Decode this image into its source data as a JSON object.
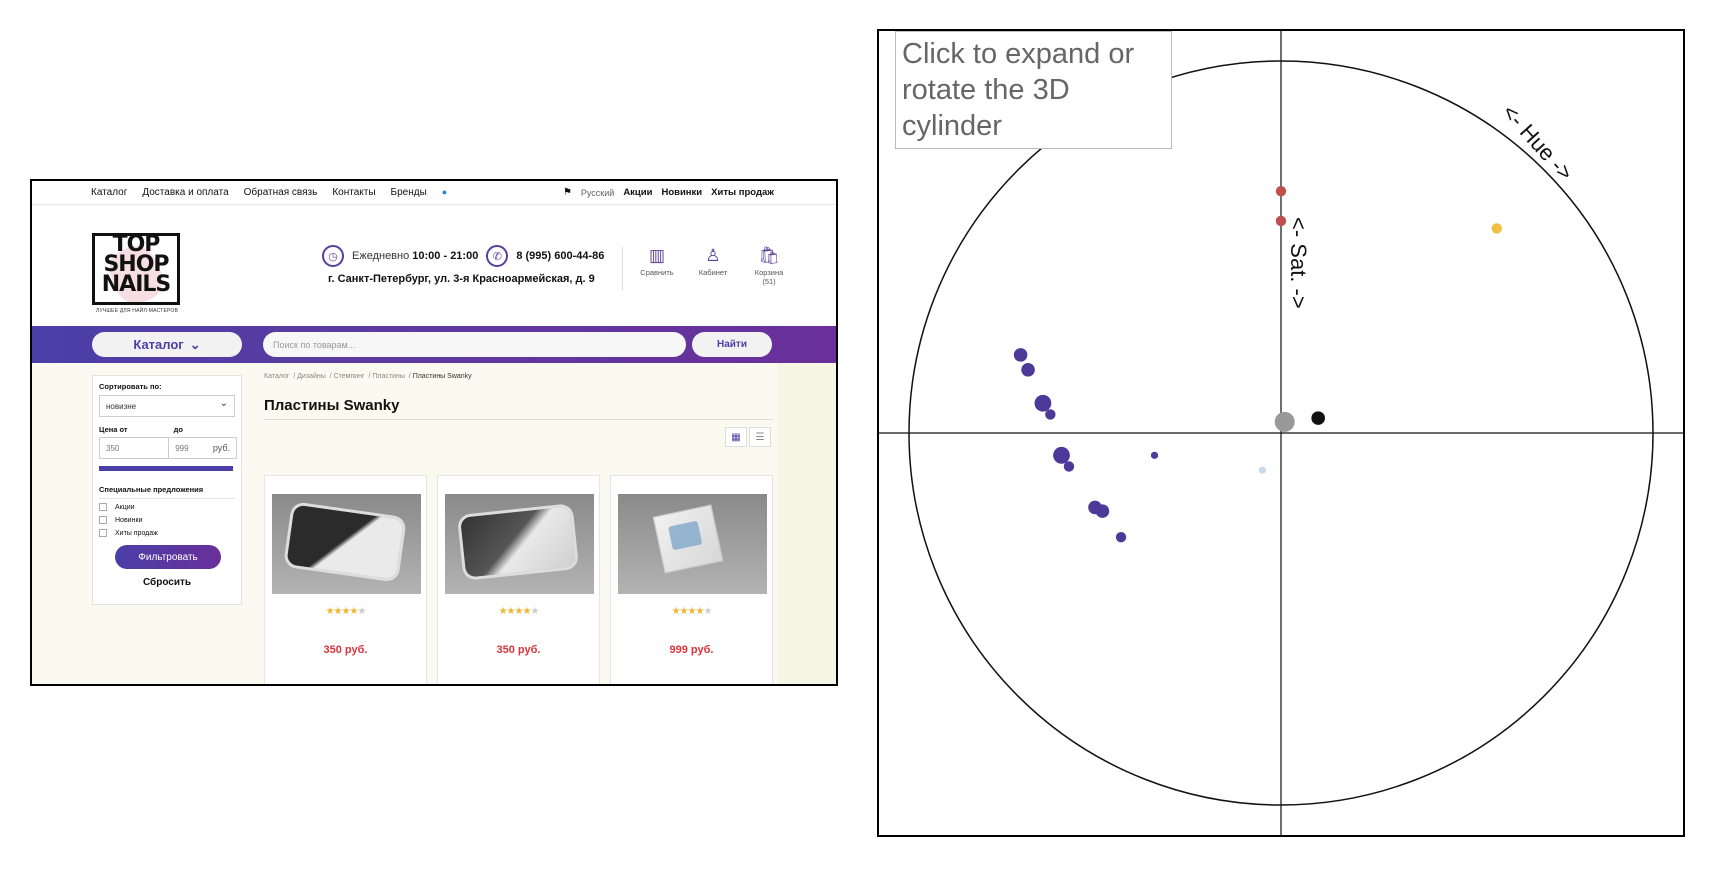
{
  "site": {
    "topnav": {
      "links": [
        "Каталог",
        "Доставка и оплата",
        "Обратная связь",
        "Контакты",
        "Бренды"
      ],
      "language": "Русский",
      "right_links": [
        "Акции",
        "Новинки",
        "Хиты продаж"
      ]
    },
    "logo": {
      "line1": "TOP",
      "line2": "SHOP",
      "line3": "NAILS",
      "tagline": "ЛУЧШЕЕ ДЛЯ НАЙЛ-МАСТЕРОВ"
    },
    "contacts": {
      "hours_label": "Ежедневно",
      "hours": "10:00 - 21:00",
      "phone": "8 (995) 600-44-86",
      "address": "г. Санкт-Петербург, ул. 3-я Красноармейская, д. 9"
    },
    "user_icons": [
      {
        "label": "Сравнить",
        "icon": "compare-icon"
      },
      {
        "label": "Кабинет",
        "icon": "user-icon"
      },
      {
        "label": "Корзина (51)",
        "icon": "cart-icon"
      }
    ],
    "search": {
      "catalog_button": "Каталог",
      "placeholder": "Поиск по товарам...",
      "find_button": "Найти"
    },
    "filters": {
      "sort_label": "Сортировать по:",
      "sort_value": "новизне",
      "price_from_label": "Цена от",
      "price_to_label": "до",
      "price_from": "350",
      "price_to": "999",
      "currency": "руб.",
      "special_label": "Специальные предложения",
      "options": [
        "Акции",
        "Новинки",
        "Хиты продаж"
      ],
      "filter_button": "Фильтровать",
      "reset_button": "Сбросить"
    },
    "breadcrumbs": [
      "Каталог",
      "Дизайны",
      "Стемпинг",
      "Пластины",
      "Пластины Swanky"
    ],
    "page_title": "Пластины Swanky",
    "products": [
      {
        "price": "350 руб.",
        "rating": 4
      },
      {
        "price": "350 руб.",
        "rating": 4
      },
      {
        "price": "999 руб.",
        "rating": 4
      }
    ]
  },
  "plot": {
    "expand_text": "Click to expand or rotate the 3D cylinder",
    "hue_label": "<- Hue ->",
    "sat_label": "<- Sat. ->",
    "colors": {
      "purple": "#4b3a9a",
      "red": "#c0504d",
      "yellow": "#f0c040",
      "black": "#111111",
      "gray": "#999999",
      "lightblue": "#c9d8ee",
      "pink": "#e8c4c4"
    }
  },
  "chart_data": {
    "type": "scatter",
    "x": [
      -0.7,
      -0.68,
      -0.64,
      -0.62,
      -0.59,
      -0.57,
      -0.5,
      -0.48,
      -0.43,
      0.0,
      0.0,
      0.1,
      -0.34,
      -0.05,
      0.58,
      0.01
    ],
    "y": [
      0.21,
      0.17,
      0.08,
      0.05,
      -0.06,
      -0.09,
      -0.2,
      -0.21,
      -0.28,
      0.65,
      0.57,
      0.04,
      -0.06,
      -0.1,
      0.55,
      0.03
    ],
    "colors": [
      "purple",
      "purple",
      "purple",
      "purple",
      "purple",
      "purple",
      "purple",
      "purple",
      "purple",
      "red",
      "red",
      "black",
      "purple",
      "lightblue",
      "yellow",
      "gray"
    ],
    "sizes": [
      3,
      3,
      4,
      2,
      4,
      2,
      3,
      3,
      2,
      2,
      2,
      3,
      1,
      1,
      2,
      5
    ]
  }
}
